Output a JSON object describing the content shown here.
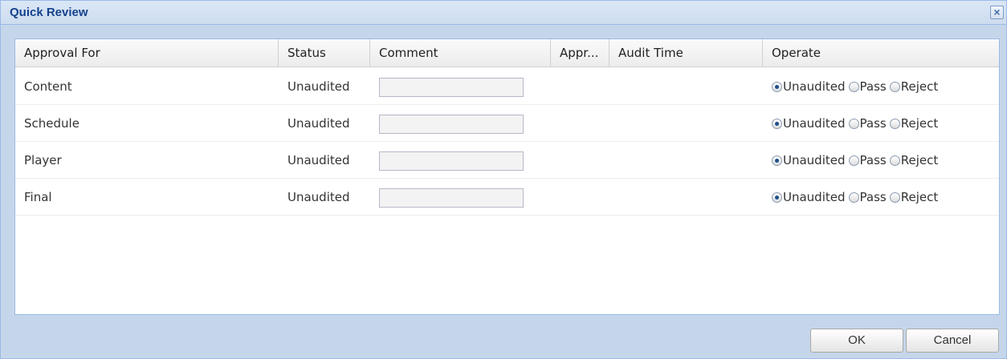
{
  "dialog": {
    "title": "Quick Review",
    "close_icon": "close-icon"
  },
  "grid": {
    "columns": [
      "Approval For",
      "Status",
      "Comment",
      "Appr...",
      "Audit Time",
      "Operate"
    ],
    "rows": [
      {
        "approval_for": "Content",
        "status": "Unaudited",
        "comment": "",
        "approver": "",
        "audit_time": "",
        "selected": "Unaudited"
      },
      {
        "approval_for": "Schedule",
        "status": "Unaudited",
        "comment": "",
        "approver": "",
        "audit_time": "",
        "selected": "Unaudited"
      },
      {
        "approval_for": "Player",
        "status": "Unaudited",
        "comment": "",
        "approver": "",
        "audit_time": "",
        "selected": "Unaudited"
      },
      {
        "approval_for": "Final",
        "status": "Unaudited",
        "comment": "",
        "approver": "",
        "audit_time": "",
        "selected": "Unaudited"
      }
    ],
    "operate_options": [
      "Unaudited",
      "Pass",
      "Reject"
    ]
  },
  "buttons": {
    "ok": "OK",
    "cancel": "Cancel"
  },
  "colors": {
    "title_text": "#15428b",
    "dialog_bg": "#c6d6ea",
    "border": "#99bbe8"
  }
}
